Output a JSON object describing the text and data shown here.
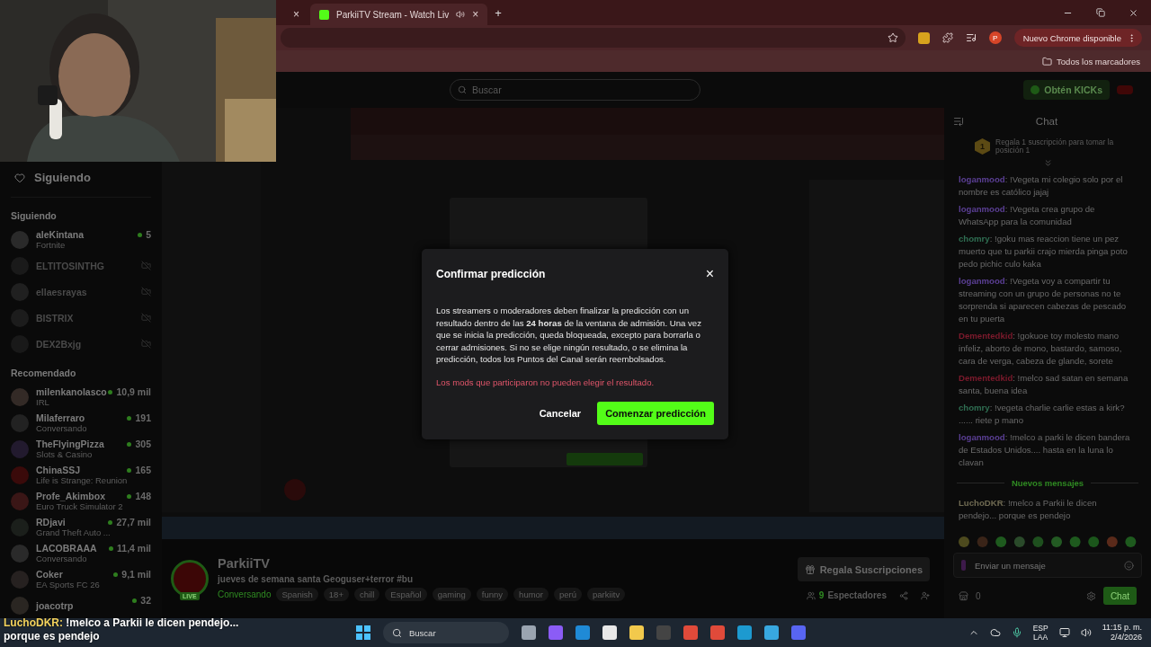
{
  "browser": {
    "tabs": [
      {
        "close": "×",
        "selected": false
      },
      {
        "title": "ParkiiTV Stream - Watch Liv",
        "close": "×",
        "selected": true
      }
    ],
    "new_tab": "+",
    "update_button": "Nuevo Chrome disponible",
    "profile": "P",
    "bookmarks": "Todos los marcadores"
  },
  "header": {
    "search_placeholder": "Buscar",
    "kicks_button": "Obtén KICKs"
  },
  "sidebar": {
    "title": "Siguiendo",
    "following_heading": "Siguiendo",
    "following": [
      {
        "name": "aleKintana",
        "category": "Fortnite",
        "viewers": "5",
        "live": true
      },
      {
        "name": "ELTITOSINTHG",
        "live": false
      },
      {
        "name": "ellaesrayas",
        "live": false
      },
      {
        "name": "BISTRIX",
        "live": false
      },
      {
        "name": "DEX2Bxjg",
        "live": false
      }
    ],
    "recommended_heading": "Recomendado",
    "recommended": [
      {
        "name": "milenkanolasco",
        "category": "IRL",
        "viewers": "10,9 mil",
        "live": true
      },
      {
        "name": "Milaferraro",
        "category": "Conversando",
        "viewers": "191",
        "live": true
      },
      {
        "name": "TheFlyingPizza",
        "category": "Slots & Casino",
        "viewers": "305",
        "live": true
      },
      {
        "name": "ChinaSSJ",
        "category": "Life is Strange: Reunion",
        "viewers": "165",
        "live": true
      },
      {
        "name": "Profe_Akimbox",
        "category": "Euro Truck Simulator 2",
        "viewers": "148",
        "live": true
      },
      {
        "name": "RDjavi",
        "category": "Grand Theft Auto ...",
        "viewers": "27,7 mil",
        "live": true
      },
      {
        "name": "LACOBRAAA",
        "category": "Conversando",
        "viewers": "11,4 mil",
        "live": true
      },
      {
        "name": "Coker",
        "category": "EA Sports FC 26",
        "viewers": "9,1 mil",
        "live": true
      },
      {
        "name": "joacotrp",
        "viewers": "32",
        "live": true
      }
    ]
  },
  "stream": {
    "channel": "ParkiiTV",
    "live_badge": "LIVE",
    "title": "jueves de semana santa Geoguser+terror #bu",
    "category": "Conversando",
    "tags": [
      "Spanish",
      "18+",
      "chill",
      "Español",
      "gaming",
      "funny",
      "humor",
      "perú",
      "parkiitv"
    ],
    "gift_button": "Regala Suscripciones",
    "viewers": "9",
    "viewers_label": "Espectadores"
  },
  "chat": {
    "title": "Chat",
    "separator": ":",
    "gift_banner": "Regala 1 suscripción para tomar la posición 1",
    "rank": "1",
    "messages": [
      {
        "user": "loganmood",
        "color": "#5b3f95",
        "text": "!Vegeta mi colegio solo por el nombre es católico jajaj"
      },
      {
        "user": "loganmood",
        "color": "#5b3f95",
        "text": "!Vegeta crea grupo de WhatsApp para la comunidad"
      },
      {
        "user": "chomry",
        "color": "#2f6e52",
        "text": "!goku mas reaccion tiene un pez muerto que tu parkii crajo mierda pinga poto pedo pichic culo kaka"
      },
      {
        "user": "loganmood",
        "color": "#5b3f95",
        "text": "!Vegeta voy a compartir tu streaming con un grupo de personas no te sorprenda si aparecen cabezas de pescado en tu puerta"
      },
      {
        "user": "Dementedkid",
        "color": "#7c1a2c",
        "text": "!gokuoe toy molesto mano infeliz, aborto de mono, bastardo, samoso, cara de verga, cabeza de glande, sorete"
      },
      {
        "user": "Dementedkid",
        "color": "#7c1a2c",
        "text": "!melco sad satan en semana santa, buena idea"
      },
      {
        "user": "chomry",
        "color": "#2f6e52",
        "text": "!vegeta charlie carlie estas a kirk? ...... riete p mano"
      },
      {
        "user": "loganmood",
        "color": "#5b3f95",
        "text": "!melco a parki le dicen bandera de Estados Unidos.... hasta en la luna lo clavan"
      }
    ],
    "divider": "Nuevos mensajes",
    "new_messages": [
      {
        "user": "LuchoDKR",
        "color": "#6f6a52",
        "text": "!melco a Parkii le dicen pendejo... porque es pendejo"
      }
    ],
    "input_placeholder": "Enviar un mensaje",
    "points": "0",
    "send_button": "Chat"
  },
  "modal": {
    "title": "Confirmar predicción",
    "close": "×",
    "body": "Los streamers o moderadores deben finalizar la predicción con un resultado dentro de las **24 horas** de la ventana de admisión. Una vez que se inicia la predicción, queda bloqueada, excepto para borrarla o cerrar admisiones. Si no se elige ningún resultado, o se elimina la predicción, todos los Puntos del Canal serán reembolsados.",
    "warning": "Los mods que participaron no pueden elegir el resultado.",
    "cancel": "Cancelar",
    "confirm": "Comenzar predicción"
  },
  "overlay": {
    "user": "LuchoDKR",
    "separator": ":",
    "message": "!melco a Parkii le dicen pendejo... porque es pendejo"
  },
  "taskbar": {
    "search": "Buscar",
    "language": "ESP",
    "layout": "LAA",
    "time": "11:15 p. m.",
    "date": "2/4/2026"
  }
}
